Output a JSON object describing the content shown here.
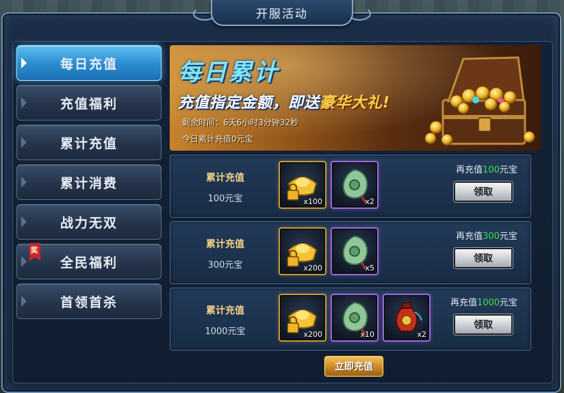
{
  "window": {
    "title": "开服活动"
  },
  "sidebar": {
    "items": [
      {
        "label": "每日充值",
        "active": true
      },
      {
        "label": "充值福利"
      },
      {
        "label": "累计充值"
      },
      {
        "label": "累计消费"
      },
      {
        "label": "战力无双"
      },
      {
        "label": "全民福利",
        "badge": "奖"
      },
      {
        "label": "首领首杀"
      }
    ]
  },
  "banner": {
    "title": "每日累计",
    "subtitle_prefix": "充值指定金额，即送",
    "subtitle_highlight": "豪华大礼!",
    "countdown": "剩余时间：6天6小时3分钟32秒",
    "today_total": "今日累计充值0元宝"
  },
  "rewards": [
    {
      "label": "累计充值",
      "amount": "100元宝",
      "need_prefix": "再充值",
      "need_amount": "100",
      "need_suffix": "元宝",
      "claim_label": "领取",
      "items": [
        {
          "icon": "gold-ingot-icon",
          "qty": "x100"
        },
        {
          "icon": "jade-pendant-icon",
          "qty": "x2"
        }
      ]
    },
    {
      "label": "累计充值",
      "amount": "300元宝",
      "need_prefix": "再充值",
      "need_amount": "300",
      "need_suffix": "元宝",
      "claim_label": "领取",
      "items": [
        {
          "icon": "gold-ingot-icon",
          "qty": "x200"
        },
        {
          "icon": "jade-pendant-icon",
          "qty": "x5"
        }
      ]
    },
    {
      "label": "累计充值",
      "amount": "1000元宝",
      "need_prefix": "再充值",
      "need_amount": "1000",
      "need_suffix": "元宝",
      "claim_label": "领取",
      "items": [
        {
          "icon": "gold-ingot-icon",
          "qty": "x200"
        },
        {
          "icon": "jade-pendant-icon",
          "qty": "x10"
        },
        {
          "icon": "red-vase-icon",
          "qty": "x2"
        }
      ]
    }
  ],
  "footer": {
    "recharge_label": "立即充值"
  },
  "colors": {
    "need_amount": "#3fe04a",
    "active_tab": "#2c8fd3",
    "label_gold": "#f6d485"
  }
}
